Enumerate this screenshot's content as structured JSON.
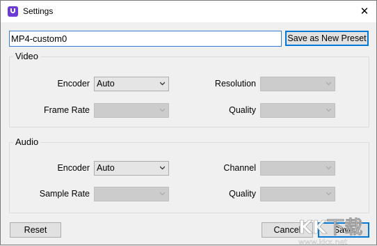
{
  "window": {
    "title": "Settings",
    "close_glyph": "✕"
  },
  "preset": {
    "name_value": "MP4-custom0",
    "save_new_label": "Save as New Preset"
  },
  "video": {
    "group_label": "Video",
    "encoder_label": "Encoder",
    "encoder_value": "Auto",
    "resolution_label": "Resolution",
    "resolution_value": "",
    "framerate_label": "Frame Rate",
    "framerate_value": "",
    "quality_label": "Quality",
    "quality_value": ""
  },
  "audio": {
    "group_label": "Audio",
    "encoder_label": "Encoder",
    "encoder_value": "Auto",
    "channel_label": "Channel",
    "channel_value": "",
    "samplerate_label": "Sample Rate",
    "samplerate_value": "",
    "quality_label": "Quality",
    "quality_value": ""
  },
  "footer": {
    "reset_label": "Reset",
    "cancel_label": "Cancel",
    "save_label": "Save"
  },
  "watermark": {
    "line1": "KK下载",
    "line2": "www.kkx.net"
  },
  "colors": {
    "accent": "#0078d7",
    "app_icon": "#6d3bd6",
    "watermark": "#ffffff"
  }
}
